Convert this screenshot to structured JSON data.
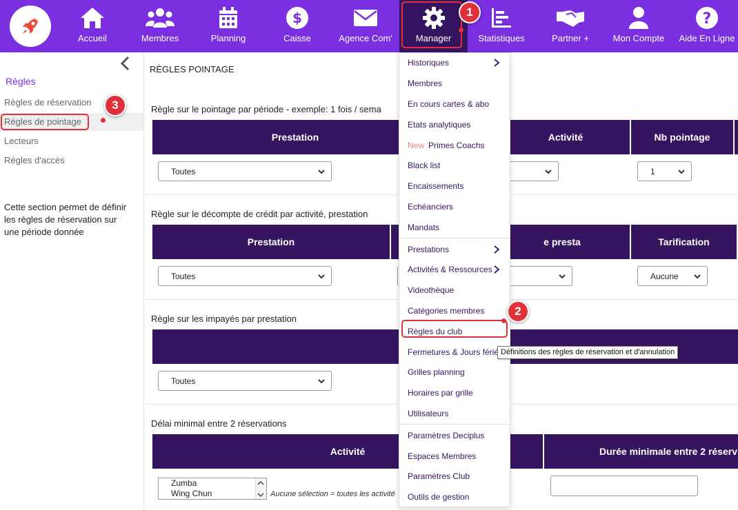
{
  "nav": {
    "items": [
      {
        "label": "Accueil",
        "icon": "home-icon"
      },
      {
        "label": "Membres",
        "icon": "users-icon"
      },
      {
        "label": "Planning",
        "icon": "calendar-icon"
      },
      {
        "label": "Caisse",
        "icon": "dollar-icon"
      },
      {
        "label": "Agence Com'",
        "icon": "mail-icon"
      },
      {
        "label": "Manager",
        "icon": "gear-icon"
      },
      {
        "label": "Statistiques",
        "icon": "stats-icon"
      },
      {
        "label": "Partner +",
        "icon": "handshake-icon"
      },
      {
        "label": "Mon Compte",
        "icon": "user-icon"
      },
      {
        "label": "Aide En Ligne",
        "icon": "help-icon"
      }
    ],
    "active": "Manager"
  },
  "colors": {
    "brand": "#7a2fe0",
    "dark": "#35155f",
    "annotation": "#e0303a"
  },
  "badges": {
    "one": "1",
    "two": "2",
    "three": "3"
  },
  "sidebar": {
    "title": "Règles",
    "links": [
      "Règles de réservation",
      "Règles de pointage",
      "Lecteurs",
      "Règles d'accès"
    ],
    "active": "Règles de pointage",
    "description": "Cette section permet de définir les règles de réservation sur une période donnée"
  },
  "main": {
    "page_title": "RÈGLES POINTAGE",
    "section1": {
      "title": "Règle sur le pointage par période - exemple: 1 fois / sema",
      "headers": [
        "Prestation",
        "Activité",
        "Nb pointage"
      ],
      "select_prestation": "Toutes",
      "select_nb": "1"
    },
    "section2": {
      "title": "Règle sur le décompte de crédit par activité, prestation",
      "headers": [
        "Prestation",
        "e presta",
        "Tarification"
      ],
      "select_prestation": "Toutes",
      "select_tarif": "Aucune"
    },
    "section3": {
      "title": "Règle sur les impayés par prestation",
      "select_prestation": "Toutes"
    },
    "section4": {
      "title": "Délai minimal entre 2 réservations",
      "headers": [
        "Activité",
        "Durée minimale entre 2 réserv"
      ],
      "list": [
        "Zumba",
        "Wing Chun"
      ],
      "hint": "Aucune sélection = toutes les activité"
    }
  },
  "dropdown": {
    "items": [
      {
        "label": "Historiques",
        "arrow": true
      },
      {
        "label": "Membres"
      },
      {
        "label": "En cours cartes & abo"
      },
      {
        "label": "Etats analytiques"
      },
      {
        "label": "Primes Coachs",
        "prefix": "New"
      },
      {
        "label": "Black list"
      },
      {
        "label": "Encaissements"
      },
      {
        "label": "Echéanciers"
      },
      {
        "label": "Mandats"
      },
      {
        "label": "Prestations",
        "arrow": true
      },
      {
        "label": "Activités & Ressources",
        "arrow": true
      },
      {
        "label": "Videothèque"
      },
      {
        "label": "Catégories membres"
      },
      {
        "label": "Règles du club"
      },
      {
        "label": "Fermetures & Jours férié"
      },
      {
        "label": "Grilles planning"
      },
      {
        "label": "Horaires par grille"
      },
      {
        "label": "Utilisateurs"
      },
      {
        "label": "Paramètres Deciplus"
      },
      {
        "label": "Espaces Membres"
      },
      {
        "label": "Paramètres Club"
      },
      {
        "label": "Outils de gestion"
      }
    ]
  },
  "tooltip": "Définitions des règles de réservation et d'annulation"
}
